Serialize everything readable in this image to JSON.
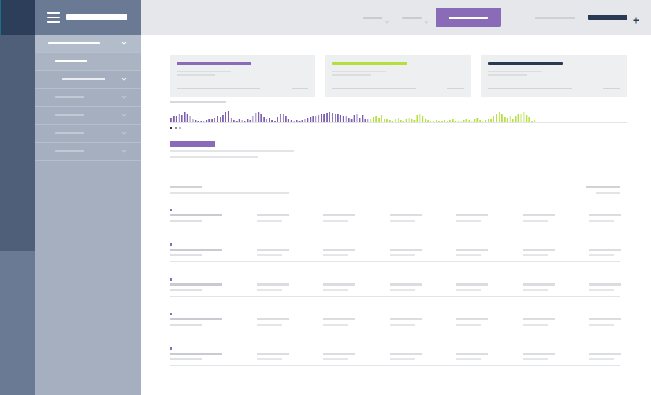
{
  "app": {
    "title": "",
    "accent": "#8a6bb8",
    "lime": "#b5de3f",
    "navy": "#2a3a55"
  },
  "sidebar": {
    "menu_icon": "hamburger-icon",
    "items": [
      {
        "label": "",
        "expanded": true
      },
      {
        "label": "",
        "active": true
      },
      {
        "label": ""
      },
      {
        "label": ""
      },
      {
        "label": ""
      },
      {
        "label": ""
      },
      {
        "label": ""
      }
    ]
  },
  "topbar": {
    "dropdown_1": "",
    "dropdown_2": "",
    "primary_button": "",
    "user_name": "",
    "account_name": "",
    "add_icon": "plus-icon"
  },
  "cards": [
    {
      "title": "",
      "color": "#8a6bb8"
    },
    {
      "title": "",
      "color": "#b5de3f"
    },
    {
      "title": "",
      "color": "#2a3a55"
    }
  ],
  "sparkline": {
    "label": "",
    "series_a_color": "#7b5eae",
    "series_b_color": "#b5de3f",
    "series_a": [
      6,
      9,
      8,
      11,
      10,
      14,
      12,
      9,
      5,
      3,
      1,
      1,
      2,
      3,
      5,
      4,
      6,
      8,
      7,
      10,
      14,
      16,
      6,
      3,
      2,
      4,
      3,
      2,
      4,
      3,
      8,
      13,
      14,
      11,
      7,
      4,
      6,
      3,
      2,
      7,
      11,
      12,
      9,
      4,
      3,
      2,
      3,
      1,
      3,
      5,
      6,
      7,
      8,
      9,
      10,
      11,
      12,
      13,
      14,
      13,
      12,
      11,
      10,
      9,
      8,
      6,
      4,
      10,
      12,
      6,
      10,
      4,
      5
    ],
    "series_b": [
      5,
      7,
      8,
      6,
      10,
      5,
      4,
      3,
      2,
      4,
      6,
      3,
      2,
      4,
      6,
      5,
      3,
      10,
      11,
      8,
      4,
      3,
      2,
      1,
      3,
      1,
      2,
      3,
      2,
      3,
      4,
      2,
      1,
      2,
      3,
      4,
      3,
      2,
      4,
      6,
      3,
      2,
      3,
      4,
      5,
      8,
      11,
      14,
      12,
      7,
      6,
      8,
      5,
      9,
      11,
      12,
      14,
      10,
      7,
      2,
      3
    ],
    "pager_count": 3
  },
  "section": {
    "title": "",
    "line1": "",
    "line2": ""
  },
  "table": {
    "header_left": "",
    "header_sub": "",
    "header_right": "",
    "header_right_sub": "",
    "rows": [
      {
        "name": "",
        "meta": ""
      },
      {
        "name": "",
        "meta": ""
      },
      {
        "name": "",
        "meta": ""
      },
      {
        "name": "",
        "meta": ""
      },
      {
        "name": "",
        "meta": ""
      }
    ]
  }
}
